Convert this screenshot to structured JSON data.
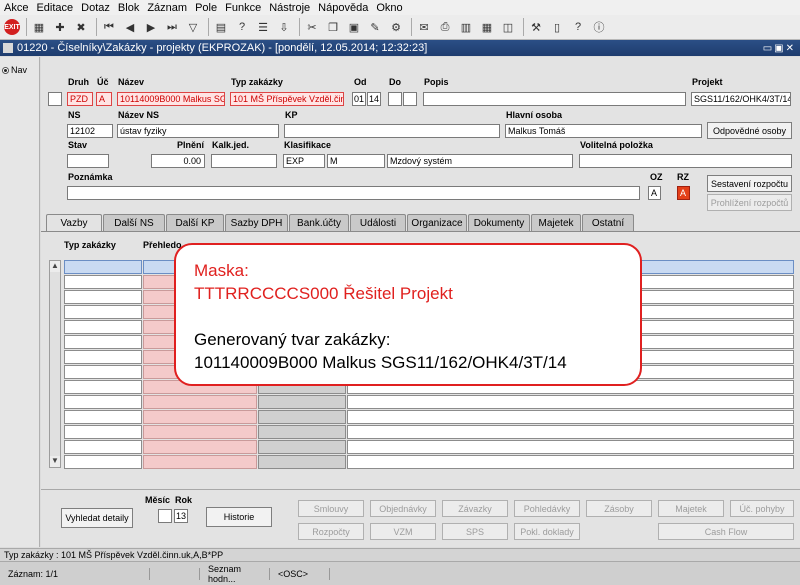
{
  "menu": [
    "Akce",
    "Editace",
    "Dotaz",
    "Blok",
    "Záznam",
    "Pole",
    "Funkce",
    "Nástroje",
    "Nápověda",
    "Okno"
  ],
  "window_title": "01220 - Číselníky\\Zakázky - projekty (EKPROZAK) - [pondělí, 12.05.2014; 12:32:23]",
  "toolbar": {
    "exit_label": "EXIT"
  },
  "nav_label": "Nav",
  "labels": {
    "druh": "Druh",
    "uc": "Úč",
    "nazev": "Název",
    "typ_zakazky": "Typ zakázky",
    "od": "Od",
    "do": "Do",
    "popis": "Popis",
    "projekt": "Projekt",
    "ns": "NS",
    "nazev_ns": "Název NS",
    "kp": "KP",
    "hlavni_osoba": "Hlavní osoba",
    "stav": "Stav",
    "plneni": "Plnění",
    "kalk_jed": "Kalk.jed.",
    "klasifikace": "Klasifikace",
    "volitelna": "Volitelná položka",
    "poznamka": "Poznámka",
    "oz": "OZ",
    "rz": "RZ",
    "mesic": "Měsíc",
    "rok": "Rok"
  },
  "fields": {
    "druh": "PZD",
    "uc": "A",
    "nazev": "10114009B000 Malkus SG",
    "typ_zakazky": "101 MŠ Příspěvek Vzděl.činn",
    "od": "01",
    "od2": "14",
    "popis": "",
    "projekt": "SGS11/162/OHK4/3T/14",
    "ns": "12102",
    "nazev_ns": "ústav fyziky",
    "kp": "",
    "hlavni_osoba": "Malkus Tomáš",
    "stav": "",
    "plneni": "0.00",
    "kalk_jed": "",
    "klas1": "EXP",
    "klas2": "M",
    "klas3": "Mzdový systém",
    "volitelna": "",
    "poznamka": "",
    "oz": "A",
    "rz": "A",
    "rok": "13"
  },
  "buttons": {
    "odpovedne_osoby": "Odpovědné osoby",
    "sestaveni_rozpoctu": "Sestavení rozpočtu",
    "prohlizeni_rozpoctu": "Prohlížení rozpočtů",
    "vyhledat_detaily": "Vyhledat detaily",
    "historie": "Historie",
    "smlouvy": "Smlouvy",
    "objednavky": "Objednávky",
    "zavazky": "Závazky",
    "pohledavky": "Pohledávky",
    "zasoby": "Zásoby",
    "majetek": "Majetek",
    "uc_pohyby": "Úč. pohyby",
    "rozpocty": "Rozpočty",
    "vzm": "VZM",
    "sps": "SPS",
    "pokl_doklady": "Pokl. doklady",
    "cash_flow": "Cash Flow"
  },
  "tabs": [
    "Vazby",
    "Další NS",
    "Další KP",
    "Sazby DPH",
    "Bank.účty",
    "Události",
    "Organizace",
    "Dokumenty",
    "Majetek",
    "Ostatní"
  ],
  "grid": {
    "col1": "Typ zakázky",
    "col2": "Přehledo"
  },
  "callout": {
    "line1": "Maska:",
    "line2": "TTTRRCCCCS000 Řešitel Projekt",
    "line3": "Generovaný tvar zakázky:",
    "line4": "101140009B000 Malkus SGS11/162/OHK4/3T/14"
  },
  "status": {
    "hint": "Typ zakázky : 101 MŠ Příspěvek Vzděl.činn.uk,A,B*PP",
    "record": "Záznam: 1/1",
    "list": "Seznam hodn...",
    "osc": "<OSC>"
  }
}
